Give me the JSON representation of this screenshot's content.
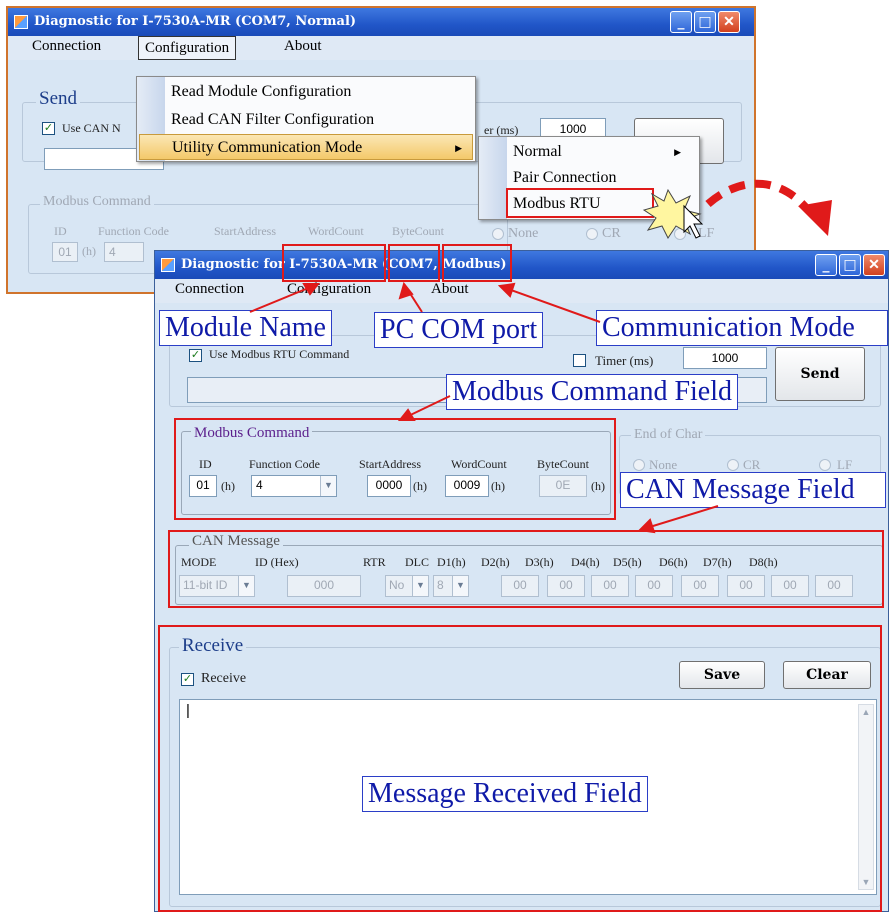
{
  "win1": {
    "title": "Diagnostic for I-7530A-MR (COM7, Normal)",
    "menu": [
      "Connection",
      "Configuration",
      "About"
    ],
    "send_legend": "Send",
    "use_can_label": "Use CAN N",
    "timer_label": "er (ms)",
    "timer_value": "1000",
    "modbus_legend": "Modbus Command",
    "id_label": "ID",
    "func_label": "Function Code",
    "start_label": "StartAddress",
    "word_label": "WordCount",
    "byte_label": "ByteCount",
    "id_value": "01",
    "h": "(h)",
    "func_value": "4",
    "none_label": "None",
    "cr_label": "CR",
    "lf_label": "LF"
  },
  "config_menu": {
    "items": [
      "Read Module Configuration",
      "Read CAN Filter Configuration",
      "Utility Communication Mode"
    ]
  },
  "sub_menu": {
    "items": [
      "Normal",
      "Pair Connection",
      "Modbus RTU"
    ]
  },
  "win2": {
    "title": "Diagnostic for I-7530A-MR (COM7, Modbus)",
    "menu": [
      "Connection",
      "Configuration",
      "About"
    ],
    "use_modbus_label": "Use Modbus RTU Command",
    "timer_label": "Timer (ms)",
    "timer_value": "1000",
    "send_button": "Send",
    "modbus_legend": "Modbus Command",
    "id_label": "ID",
    "func_label": "Function Code",
    "start_label": "StartAddress",
    "word_label": "WordCount",
    "byte_label": "ByteCount",
    "h": "(h)",
    "id_value": "01",
    "func_value": "4",
    "start_value": "0000",
    "word_value": "0009",
    "byte_value": "0E",
    "eoc_legend": "End of Char",
    "none_label": "None",
    "cr_label": "CR",
    "lf_label": "LF",
    "can_legend": "CAN Message",
    "can_headers": [
      "MODE",
      "ID (Hex)",
      "RTR",
      "DLC",
      "D1(h)",
      "D2(h)",
      "D3(h)",
      "D4(h)",
      "D5(h)",
      "D6(h)",
      "D7(h)",
      "D8(h)"
    ],
    "can_values": {
      "mode": "11-bit ID",
      "id": "000",
      "rtr": "No",
      "dlc": "8",
      "data": [
        "00",
        "00",
        "00",
        "00",
        "00",
        "00",
        "00",
        "00"
      ]
    },
    "receive_legend": "Receive",
    "receive_label": "Receive",
    "save_button": "Save",
    "clear_button": "Clear",
    "receive_text": "|"
  },
  "annotations": {
    "module_name": "Module Name",
    "pc_com_port": "PC COM port",
    "communication_mode": "Communication Mode",
    "modbus_command_field": "Modbus Command Field",
    "can_message_field": "CAN Message Field",
    "message_received_field": "Message Received Field"
  },
  "colors": {
    "annotation_red": "#e01a1a",
    "annotation_blue": "#0f1aa8",
    "titlebar_blue": "#2156c8"
  }
}
